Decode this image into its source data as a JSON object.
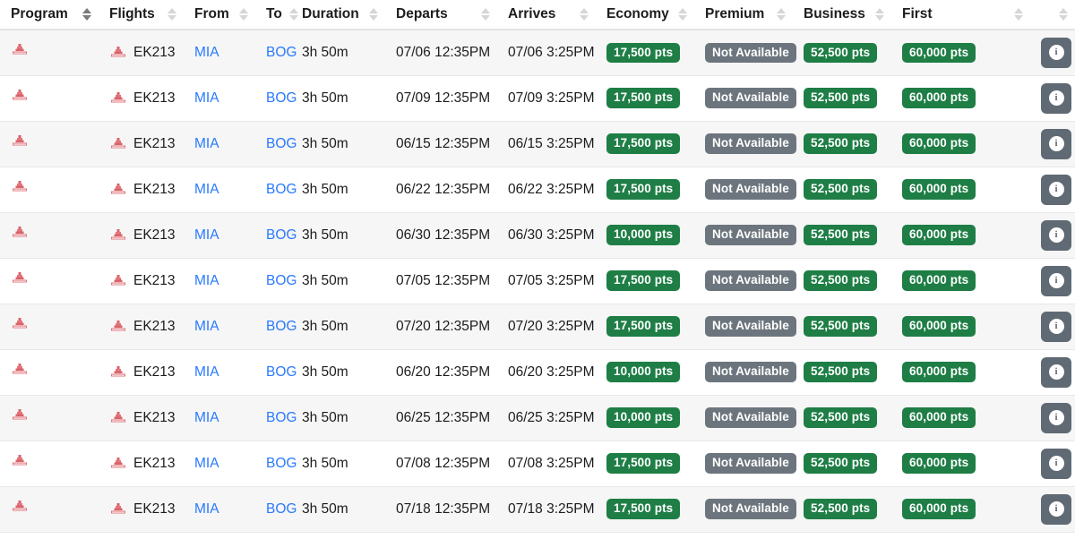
{
  "table": {
    "columns": [
      {
        "key": "program",
        "label": "Program",
        "sortable": true,
        "sort_active": true
      },
      {
        "key": "flights",
        "label": "Flights",
        "sortable": true,
        "sort_active": false
      },
      {
        "key": "from",
        "label": "From",
        "sortable": true,
        "sort_active": false
      },
      {
        "key": "to",
        "label": "To",
        "sortable": true,
        "sort_active": false
      },
      {
        "key": "duration",
        "label": "Duration",
        "sortable": true,
        "sort_active": false
      },
      {
        "key": "departs",
        "label": "Departs",
        "sortable": true,
        "sort_active": false
      },
      {
        "key": "arrives",
        "label": "Arrives",
        "sortable": true,
        "sort_active": false
      },
      {
        "key": "economy",
        "label": "Economy",
        "sortable": true,
        "sort_active": false
      },
      {
        "key": "premium",
        "label": "Premium",
        "sortable": true,
        "sort_active": false
      },
      {
        "key": "business",
        "label": "Business",
        "sortable": true,
        "sort_active": false
      },
      {
        "key": "first",
        "label": "First",
        "sortable": true,
        "sort_active": false
      },
      {
        "key": "info",
        "label": "",
        "sortable": true,
        "sort_active": false
      }
    ],
    "not_available_label": "Not Available",
    "info_glyph": "i",
    "airline_logo_name": "emirates-logo",
    "colors": {
      "available_badge": "#1e7e45",
      "unavailable_badge": "#6c757d",
      "link": "#2979ff",
      "info_button": "#5f6a74",
      "row_stripe": "#f6f6f6",
      "logo_red": "#d71921"
    },
    "rows": [
      {
        "flight": "EK213",
        "from": "MIA",
        "to": "BOG",
        "duration": "3h 50m",
        "departs": "07/06 12:35PM",
        "arrives": "07/06 3:25PM",
        "economy": "17,500 pts",
        "premium": "Not Available",
        "business": "52,500 pts",
        "first": "60,000 pts"
      },
      {
        "flight": "EK213",
        "from": "MIA",
        "to": "BOG",
        "duration": "3h 50m",
        "departs": "07/09 12:35PM",
        "arrives": "07/09 3:25PM",
        "economy": "17,500 pts",
        "premium": "Not Available",
        "business": "52,500 pts",
        "first": "60,000 pts"
      },
      {
        "flight": "EK213",
        "from": "MIA",
        "to": "BOG",
        "duration": "3h 50m",
        "departs": "06/15 12:35PM",
        "arrives": "06/15 3:25PM",
        "economy": "17,500 pts",
        "premium": "Not Available",
        "business": "52,500 pts",
        "first": "60,000 pts"
      },
      {
        "flight": "EK213",
        "from": "MIA",
        "to": "BOG",
        "duration": "3h 50m",
        "departs": "06/22 12:35PM",
        "arrives": "06/22 3:25PM",
        "economy": "17,500 pts",
        "premium": "Not Available",
        "business": "52,500 pts",
        "first": "60,000 pts"
      },
      {
        "flight": "EK213",
        "from": "MIA",
        "to": "BOG",
        "duration": "3h 50m",
        "departs": "06/30 12:35PM",
        "arrives": "06/30 3:25PM",
        "economy": "10,000 pts",
        "premium": "Not Available",
        "business": "52,500 pts",
        "first": "60,000 pts"
      },
      {
        "flight": "EK213",
        "from": "MIA",
        "to": "BOG",
        "duration": "3h 50m",
        "departs": "07/05 12:35PM",
        "arrives": "07/05 3:25PM",
        "economy": "17,500 pts",
        "premium": "Not Available",
        "business": "52,500 pts",
        "first": "60,000 pts"
      },
      {
        "flight": "EK213",
        "from": "MIA",
        "to": "BOG",
        "duration": "3h 50m",
        "departs": "07/20 12:35PM",
        "arrives": "07/20 3:25PM",
        "economy": "17,500 pts",
        "premium": "Not Available",
        "business": "52,500 pts",
        "first": "60,000 pts"
      },
      {
        "flight": "EK213",
        "from": "MIA",
        "to": "BOG",
        "duration": "3h 50m",
        "departs": "06/20 12:35PM",
        "arrives": "06/20 3:25PM",
        "economy": "10,000 pts",
        "premium": "Not Available",
        "business": "52,500 pts",
        "first": "60,000 pts"
      },
      {
        "flight": "EK213",
        "from": "MIA",
        "to": "BOG",
        "duration": "3h 50m",
        "departs": "06/25 12:35PM",
        "arrives": "06/25 3:25PM",
        "economy": "10,000 pts",
        "premium": "Not Available",
        "business": "52,500 pts",
        "first": "60,000 pts"
      },
      {
        "flight": "EK213",
        "from": "MIA",
        "to": "BOG",
        "duration": "3h 50m",
        "departs": "07/08 12:35PM",
        "arrives": "07/08 3:25PM",
        "economy": "17,500 pts",
        "premium": "Not Available",
        "business": "52,500 pts",
        "first": "60,000 pts"
      },
      {
        "flight": "EK213",
        "from": "MIA",
        "to": "BOG",
        "duration": "3h 50m",
        "departs": "07/18 12:35PM",
        "arrives": "07/18 3:25PM",
        "economy": "17,500 pts",
        "premium": "Not Available",
        "business": "52,500 pts",
        "first": "60,000 pts"
      }
    ]
  }
}
